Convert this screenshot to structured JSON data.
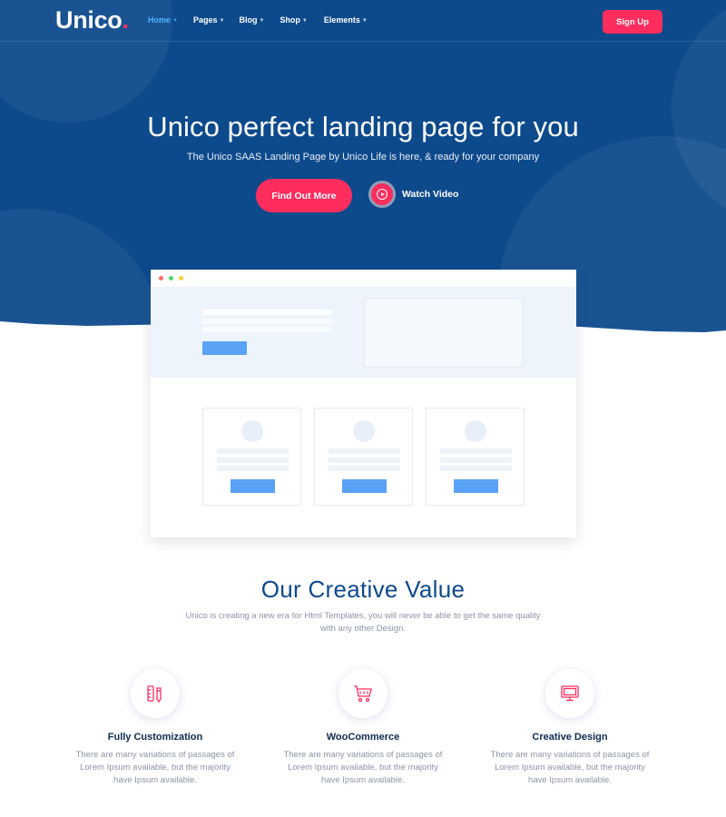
{
  "brand": {
    "name": "Unico",
    "dot": "."
  },
  "nav": {
    "items": [
      {
        "label": "Home",
        "active": true
      },
      {
        "label": "Pages"
      },
      {
        "label": "Blog"
      },
      {
        "label": "Shop"
      },
      {
        "label": "Elements"
      }
    ],
    "signup_label": "Sign Up"
  },
  "hero": {
    "title": "Unico perfect landing page for you",
    "subtitle": "The Unico SAAS Landing Page by Unico Life is here, & ready for your company",
    "cta_label": "Find Out More",
    "video_label": "Watch Video"
  },
  "value": {
    "title": "Our Creative Value",
    "description": "Unico is creating a new era for Html Templates, you will never be able to get the same quality with any other Design.",
    "features": [
      {
        "icon": "pencil-ruler-icon",
        "title": "Fully Customization",
        "text": "There are many variations of passages of Lorem Ipsum available, but the majority have Ipsum available."
      },
      {
        "icon": "shopping-cart-icon",
        "title": "WooCommerce",
        "text": "There are many variations of passages of Lorem Ipsum available, but the majority have Ipsum available."
      },
      {
        "icon": "monitor-icon",
        "title": "Creative Design",
        "text": "There are many variations of passages of Lorem Ipsum available, but the majority have Ipsum available."
      }
    ]
  },
  "colors": {
    "primary_blue": "#0d4a8c",
    "accent_pink": "#ff2d5e",
    "active_nav": "#4fb3ff",
    "mock_button": "#5aa2f5"
  }
}
